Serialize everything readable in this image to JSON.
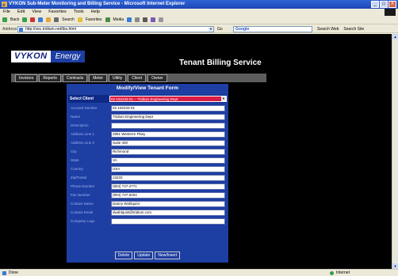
{
  "window": {
    "title": "VYKON Sub-Meter Monitoring and Billing Service - Microsoft Internet Explorer",
    "controls": [
      "_",
      "□",
      "X"
    ]
  },
  "menubar": {
    "items": [
      "File",
      "Edit",
      "View",
      "Favorites",
      "Tools",
      "Help"
    ]
  },
  "toolbar": {
    "back": "Back",
    "search": "Search",
    "favorites": "Favorites",
    "media": "Media"
  },
  "address": {
    "label": "Address",
    "url": "http://vec.tridium.net/tbs.html",
    "go": "Go",
    "google": "Google",
    "search_web": "Search Web",
    "search_site": "Search Site"
  },
  "page": {
    "brand_vykon": "VYKON",
    "brand_energy": "Energy",
    "service_title": "Tenant Billing Service",
    "nav": [
      "Invoices",
      "Reports",
      "Contracts",
      "Meter",
      "Utility",
      "Client",
      "Owner"
    ]
  },
  "form": {
    "title": "Modify/View Tenant Form",
    "select_label": "Select Client",
    "select_value": "02-192233-01 -- Tridium Engineering Dept",
    "fields": [
      {
        "label": "Account Number",
        "value": "02-192233-01"
      },
      {
        "label": "Name",
        "value": "Tridium Engineering Dept"
      },
      {
        "label": "Description",
        "value": ""
      },
      {
        "label": "Address Line 1",
        "value": "2851 Westerre Pkwy"
      },
      {
        "label": "Address Line 2",
        "value": "Suite 400"
      },
      {
        "label": "City",
        "value": "Richmond"
      },
      {
        "label": "State",
        "value": "VA"
      },
      {
        "label": "Country",
        "value": "USA"
      },
      {
        "label": "Zip/Postal",
        "value": "23233"
      },
      {
        "label": "Phone Number",
        "value": "(804) 747-4771"
      },
      {
        "label": "Fax Number",
        "value": "(804) 747-6204"
      },
      {
        "label": "Contact Name",
        "value": "Danny Wahlquist"
      },
      {
        "label": "Contact Email",
        "value": "dwahlquist@tridium.com"
      },
      {
        "label": "Company Logo",
        "value": ""
      }
    ],
    "buttons": [
      "Delete",
      "Update",
      "New/Insert"
    ]
  },
  "status": {
    "left": "Done",
    "zone": "Internet"
  },
  "colors": {
    "form_blue": "#1d3ea3",
    "select_red": "#d91d44",
    "page_bg": "#000000"
  }
}
